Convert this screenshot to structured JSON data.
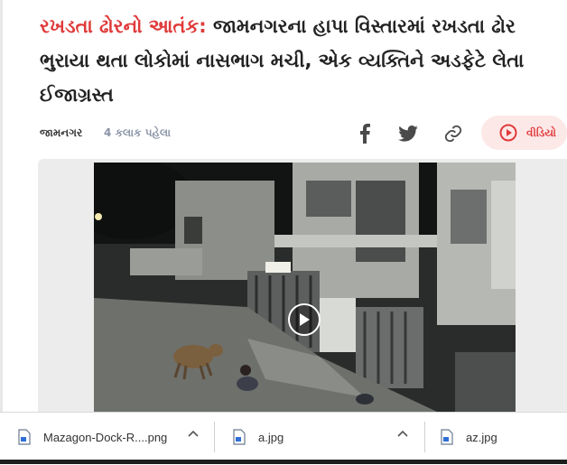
{
  "article": {
    "tag": "રખડતા ઢોરનો આતંક:",
    "title": " જામનગરના હાપા વિસ્તારમાં રખડતા ઢોર ભુરાયા થતા લોકોમાં નાસભાગ મચી, એક વ્યક્તિને અડફેટે લેતા ઈજાગ્રસ્ત",
    "city": "જામનગર",
    "time": "4 કલાક પહેલા",
    "video_label": "વીડિયો"
  },
  "share_icons": [
    "facebook-icon",
    "twitter-icon",
    "link-icon"
  ],
  "colors": {
    "accent": "#e03a3a",
    "video_bg": "#fde8e8",
    "muted": "#8a94a6"
  },
  "downloads": [
    {
      "name": "Mazagon-Dock-R....png"
    },
    {
      "name": "a.jpg"
    },
    {
      "name": "az.jpg"
    }
  ]
}
